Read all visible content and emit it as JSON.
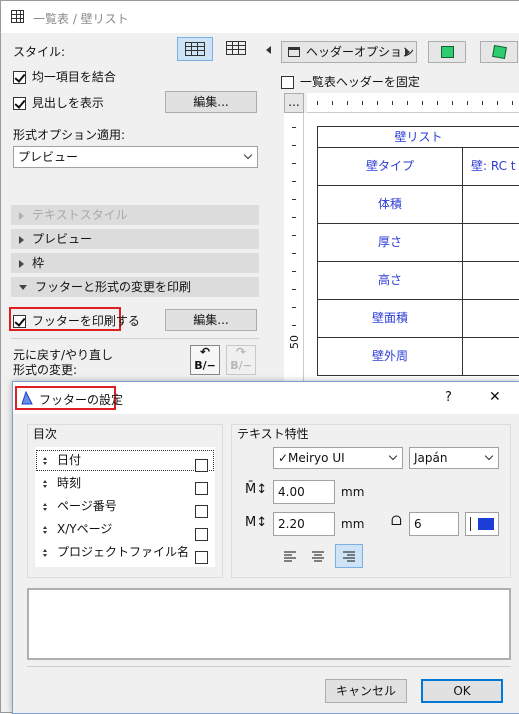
{
  "window": {
    "title": "一覧表 / 壁リスト"
  },
  "left_panel": {
    "style_label": "スタイル:",
    "merge_label": "均一項目を結合",
    "show_header_label": "見出しを表示",
    "edit_label": "編集...",
    "format_label": "形式オプション適用:",
    "format_value": "プレビュー",
    "sections": [
      "テキストスタイル",
      "プレビュー",
      "枠",
      "フッターと形式の変更を印刷"
    ],
    "print_footer_label": "フッターを印刷する",
    "edit2_label": "編集...",
    "undo_label_1": "元に戻す/やり直し",
    "undo_label_2": "形式の変更:",
    "undo_btn_text": "B/−",
    "redo_btn_text": "B/−"
  },
  "right_panel": {
    "header_options_label": "ヘッダーオプション",
    "fix_header_label": "一覧表ヘッダーを固定",
    "ellipsis_label": "...",
    "ruler_number": "50",
    "table": {
      "title": "壁リスト",
      "rows": [
        "壁タイプ",
        "体積",
        "厚さ",
        "高さ",
        "壁面積",
        "壁外周"
      ],
      "second_col_first": "壁: RC t"
    }
  },
  "dialog": {
    "title": "フッターの設定",
    "help": "?",
    "close": "✕",
    "toc_label": "目次",
    "items": [
      "日付",
      "時刻",
      "ページ番号",
      "X/Yページ",
      "プロジェクトファイル名"
    ],
    "text_props_label": "テキスト特性",
    "font_value": "✓Meiryo UI",
    "lang_value": "Japán",
    "size_value": "4.00",
    "size_unit": "mm",
    "spacing_value": "2.20",
    "spacing_unit": "mm",
    "pen_value": "6",
    "cancel_label": "キャンセル",
    "ok_label": "OK"
  },
  "colors": {
    "accent_blue": "#1a3ed6",
    "red_highlight": "#e02020",
    "table_text": "#2b3bd6"
  }
}
